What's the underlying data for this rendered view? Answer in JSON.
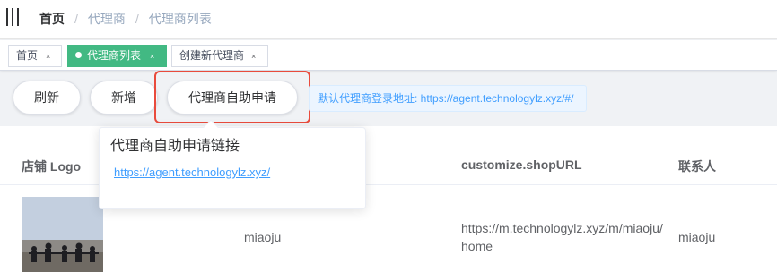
{
  "breadcrumb": {
    "home": "首页",
    "separator": "/",
    "level1": "代理商",
    "level2": "代理商列表"
  },
  "tags": [
    {
      "label": "首页",
      "close": "×",
      "active": false
    },
    {
      "label": "代理商列表",
      "close": "×",
      "active": true
    },
    {
      "label": "创建新代理商",
      "close": "×",
      "active": false
    }
  ],
  "toolbar": {
    "refresh_label": "刷新",
    "add_label": "新增",
    "self_apply_label": "代理商自助申请",
    "login_url_hint": "默认代理商登录地址: https://agent.technologylz.xyz/#/"
  },
  "popover": {
    "title": "代理商自助申请链接",
    "link_text": "https://agent.technologylz.xyz/"
  },
  "table": {
    "headers": [
      "店铺 Logo",
      "customize.shopURL",
      "联系人"
    ],
    "rows": [
      {
        "name": "miaoju",
        "shop_url": "https://m.technologylz.xyz/m/miaoju/home",
        "contact": "miaoju"
      }
    ]
  },
  "colors": {
    "accent_green": "#42b983",
    "link_blue": "#409eff",
    "highlight_red": "#e94b3c"
  }
}
